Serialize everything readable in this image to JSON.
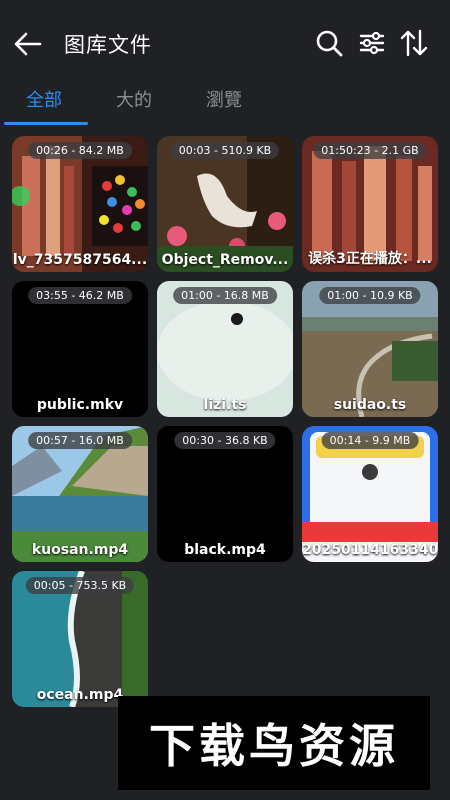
{
  "header": {
    "title": "图库文件",
    "back_icon": "arrow-left-icon",
    "search_icon": "search-icon",
    "filter_icon": "sliders-icon",
    "sort_icon": "sort-icon"
  },
  "tabs": [
    {
      "label": "全部",
      "active": true
    },
    {
      "label": "大的",
      "active": false
    },
    {
      "label": "瀏覽",
      "active": false
    }
  ],
  "files": [
    {
      "meta": "00:26 - 84.2 MB",
      "name": "lv_7357587564..."
    },
    {
      "meta": "00:03 - 510.9 KB",
      "name": "Object_Remov..."
    },
    {
      "meta": "01:50:23 - 2.1 GB",
      "name": "误杀3正在播放：..."
    },
    {
      "meta": "03:55 - 46.2 MB",
      "name": "public.mkv"
    },
    {
      "meta": "01:00 - 16.8 MB",
      "name": "lizi.ts"
    },
    {
      "meta": "01:00 - 10.9 KB",
      "name": "suidao.ts"
    },
    {
      "meta": "00:57 - 16.0 MB",
      "name": "kuosan.mp4"
    },
    {
      "meta": "00:30 - 36.8 KB",
      "name": "black.mp4"
    },
    {
      "meta": "00:14 - 9.9 MB",
      "name": "20250114163340..."
    },
    {
      "meta": "00:05 - 753.5 KB",
      "name": "ocean.mp4"
    }
  ],
  "watermark": "下载鸟资源",
  "colors": {
    "accent": "#2f8cf0",
    "background": "#1f2124"
  }
}
